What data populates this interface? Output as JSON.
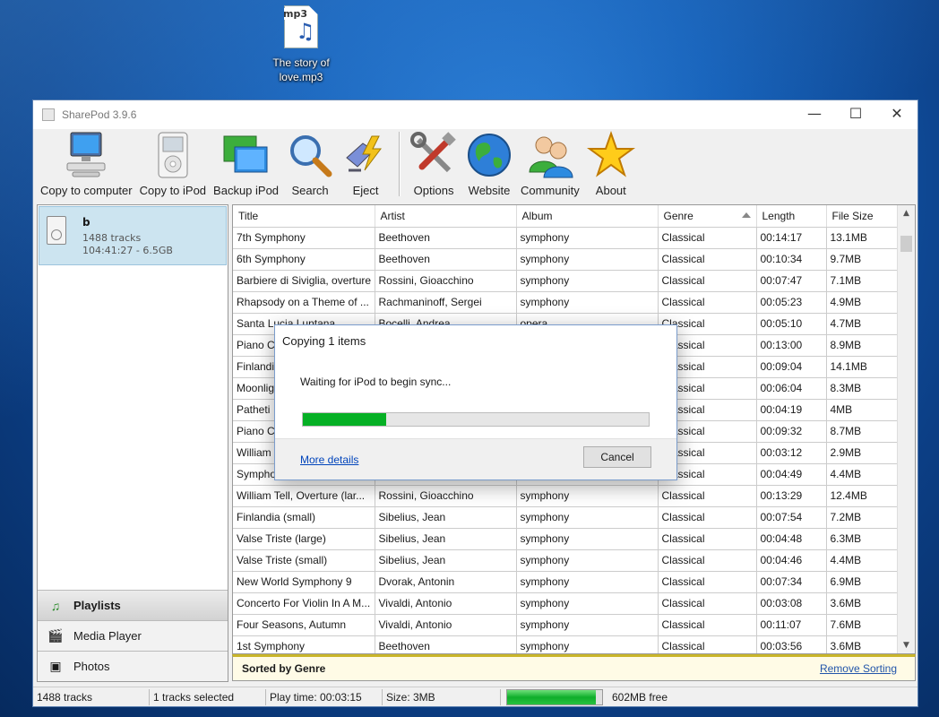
{
  "desktop": {
    "file_label_line1": "The story of",
    "file_label_line2": "love.mp3",
    "file_tag": "mp3"
  },
  "window": {
    "title": "SharePod 3.9.6",
    "min": "—",
    "max": "☐",
    "close": "✕"
  },
  "toolbar": {
    "copy_to_computer": "Copy to computer",
    "copy_to_ipod": "Copy to iPod",
    "backup_ipod": "Backup iPod",
    "search": "Search",
    "eject": "Eject",
    "options": "Options",
    "website": "Website",
    "community": "Community",
    "about": "About"
  },
  "device": {
    "name": "b",
    "tracks": "1488 tracks",
    "summary": "104:41:27 - 6.5GB"
  },
  "left_tabs": {
    "playlists": "Playlists",
    "media_player": "Media Player",
    "photos": "Photos"
  },
  "table": {
    "headers": [
      "Title",
      "Artist",
      "Album",
      "Genre",
      "Length",
      "File Size"
    ],
    "rows": [
      [
        "7th Symphony",
        "Beethoven",
        "symphony",
        "Classical",
        "00:14:17",
        "13.1MB"
      ],
      [
        "6th Symphony",
        "Beethoven",
        "symphony",
        "Classical",
        "00:10:34",
        "9.7MB"
      ],
      [
        "Barbiere di Siviglia, overture",
        "Rossini, Gioacchino",
        "symphony",
        "Classical",
        "00:07:47",
        "7.1MB"
      ],
      [
        "Rhapsody on a Theme of ...",
        "Rachmaninoff, Sergei",
        "symphony",
        "Classical",
        "00:05:23",
        "4.9MB"
      ],
      [
        "Santa Lucia Luntana",
        "Bocelli, Andrea",
        "opera",
        "Classical",
        "00:05:10",
        "4.7MB"
      ],
      [
        "Piano Co",
        "",
        "",
        "Classical",
        "00:13:00",
        "8.9MB"
      ],
      [
        "Finlandia",
        "",
        "",
        "Classical",
        "00:09:04",
        "14.1MB"
      ],
      [
        "Moonligh",
        "",
        "",
        "Classical",
        "00:06:04",
        "8.3MB"
      ],
      [
        "Patheti",
        "",
        "",
        "Classical",
        "00:04:19",
        "4MB"
      ],
      [
        "Piano Co",
        "",
        "",
        "Classical",
        "00:09:32",
        "8.7MB"
      ],
      [
        "William T",
        "",
        "",
        "Classical",
        "00:03:12",
        "2.9MB"
      ],
      [
        "Sympho",
        "",
        "",
        "Classical",
        "00:04:49",
        "4.4MB"
      ],
      [
        "William Tell, Overture (lar...",
        "Rossini, Gioacchino",
        "symphony",
        "Classical",
        "00:13:29",
        "12.4MB"
      ],
      [
        "Finlandia (small)",
        "Sibelius, Jean",
        "symphony",
        "Classical",
        "00:07:54",
        "7.2MB"
      ],
      [
        "Valse Triste (large)",
        "Sibelius, Jean",
        "symphony",
        "Classical",
        "00:04:48",
        "6.3MB"
      ],
      [
        "Valse Triste (small)",
        "Sibelius, Jean",
        "symphony",
        "Classical",
        "00:04:46",
        "4.4MB"
      ],
      [
        "New World Symphony 9",
        "Dvorak, Antonin",
        "symphony",
        "Classical",
        "00:07:34",
        "6.9MB"
      ],
      [
        "Concerto For Violin In A M...",
        "Vivaldi, Antonio",
        "symphony",
        "Classical",
        "00:03:08",
        "3.6MB"
      ],
      [
        "Four Seasons, Autumn",
        "Vivaldi, Antonio",
        "symphony",
        "Classical",
        "00:11:07",
        "7.6MB"
      ],
      [
        "1st Symphony",
        "Beethoven",
        "symphony",
        "Classical",
        "00:03:56",
        "3.6MB"
      ]
    ],
    "sorted_by": "Sorted by Genre",
    "remove_sorting": "Remove Sorting"
  },
  "status": {
    "tracks": "1488 tracks",
    "selected": "1 tracks selected",
    "play_time": "Play time: 00:03:15",
    "size": "Size: 3MB",
    "free": "602MB free",
    "free_bar_fraction": 0.93
  },
  "dialog": {
    "title": "Copying 1 items",
    "message": "Waiting for iPod to begin sync...",
    "progress_fraction": 0.24,
    "more_details": "More details",
    "cancel": "Cancel"
  }
}
